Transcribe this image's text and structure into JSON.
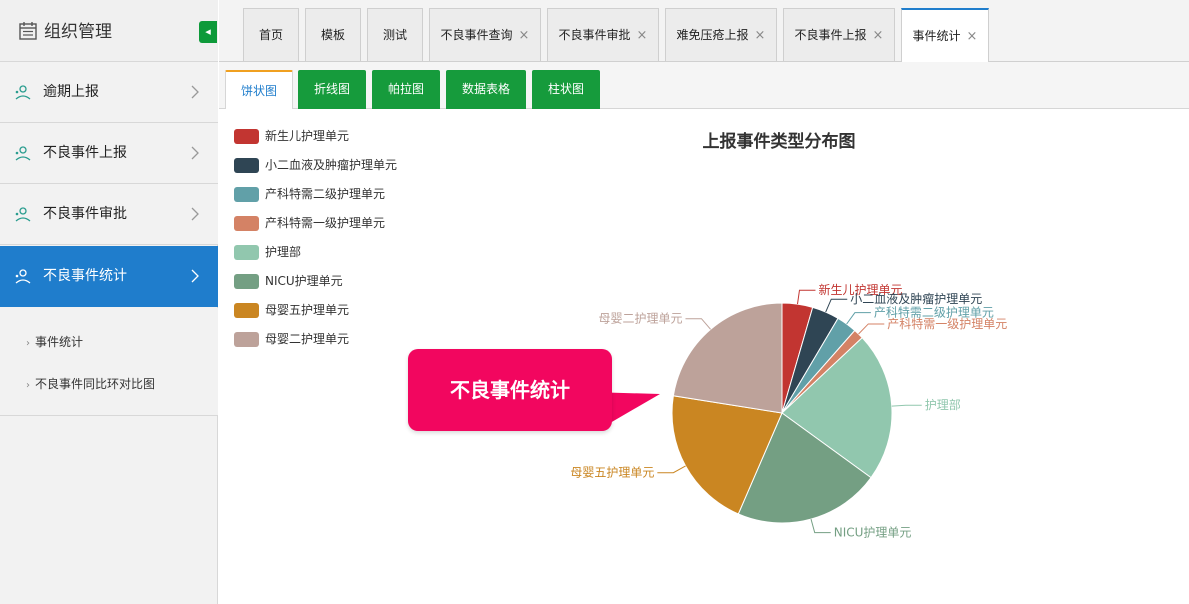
{
  "sidebar": {
    "title": "组织管理",
    "collapse_glyph": "◂",
    "menu": [
      {
        "label": "逾期上报",
        "icon": "report-icon",
        "active": false
      },
      {
        "label": "不良事件上报",
        "icon": "report-icon",
        "active": false
      },
      {
        "label": "不良事件审批",
        "icon": "report-icon",
        "active": false
      },
      {
        "label": "不良事件统计",
        "icon": "report-icon",
        "active": true
      }
    ],
    "submenu": [
      {
        "label": "事件统计"
      },
      {
        "label": "不良事件同比环对比图"
      }
    ]
  },
  "tabs": [
    {
      "label": "首页",
      "closable": false
    },
    {
      "label": "模板",
      "closable": false
    },
    {
      "label": "测试",
      "closable": false
    },
    {
      "label": "不良事件查询",
      "closable": true
    },
    {
      "label": "不良事件审批",
      "closable": true
    },
    {
      "label": "难免压疮上报",
      "closable": true
    },
    {
      "label": "不良事件上报",
      "closable": true
    },
    {
      "label": "事件统计",
      "closable": true,
      "active": true
    }
  ],
  "close_glyph": "×",
  "chart_tabs": [
    {
      "label": "饼状图",
      "active": true
    },
    {
      "label": "折线图"
    },
    {
      "label": "帕拉图"
    },
    {
      "label": "数据表格"
    },
    {
      "label": "柱状图"
    }
  ],
  "callout": {
    "text": "不良事件统计"
  },
  "chart_data": {
    "type": "pie",
    "title": "上报事件类型分布图",
    "legend_position": "top-left",
    "series": [
      {
        "name": "新生儿护理单元",
        "value": 4.5,
        "color": "#c23531"
      },
      {
        "name": "小二血液及肿瘤护理单元",
        "value": 4.0,
        "color": "#2f4554"
      },
      {
        "name": "产科特需二级护理单元",
        "value": 3.0,
        "color": "#61a0a8"
      },
      {
        "name": "产科特需一级护理单元",
        "value": 1.5,
        "color": "#d48265"
      },
      {
        "name": "护理部",
        "value": 22.0,
        "color": "#91c7ae"
      },
      {
        "name": "NICU护理单元",
        "value": 21.5,
        "color": "#749f83"
      },
      {
        "name": "母婴五护理单元",
        "value": 21.0,
        "color": "#ca8622"
      },
      {
        "name": "母婴二护理单元",
        "value": 22.5,
        "color": "#bda29a"
      }
    ]
  }
}
